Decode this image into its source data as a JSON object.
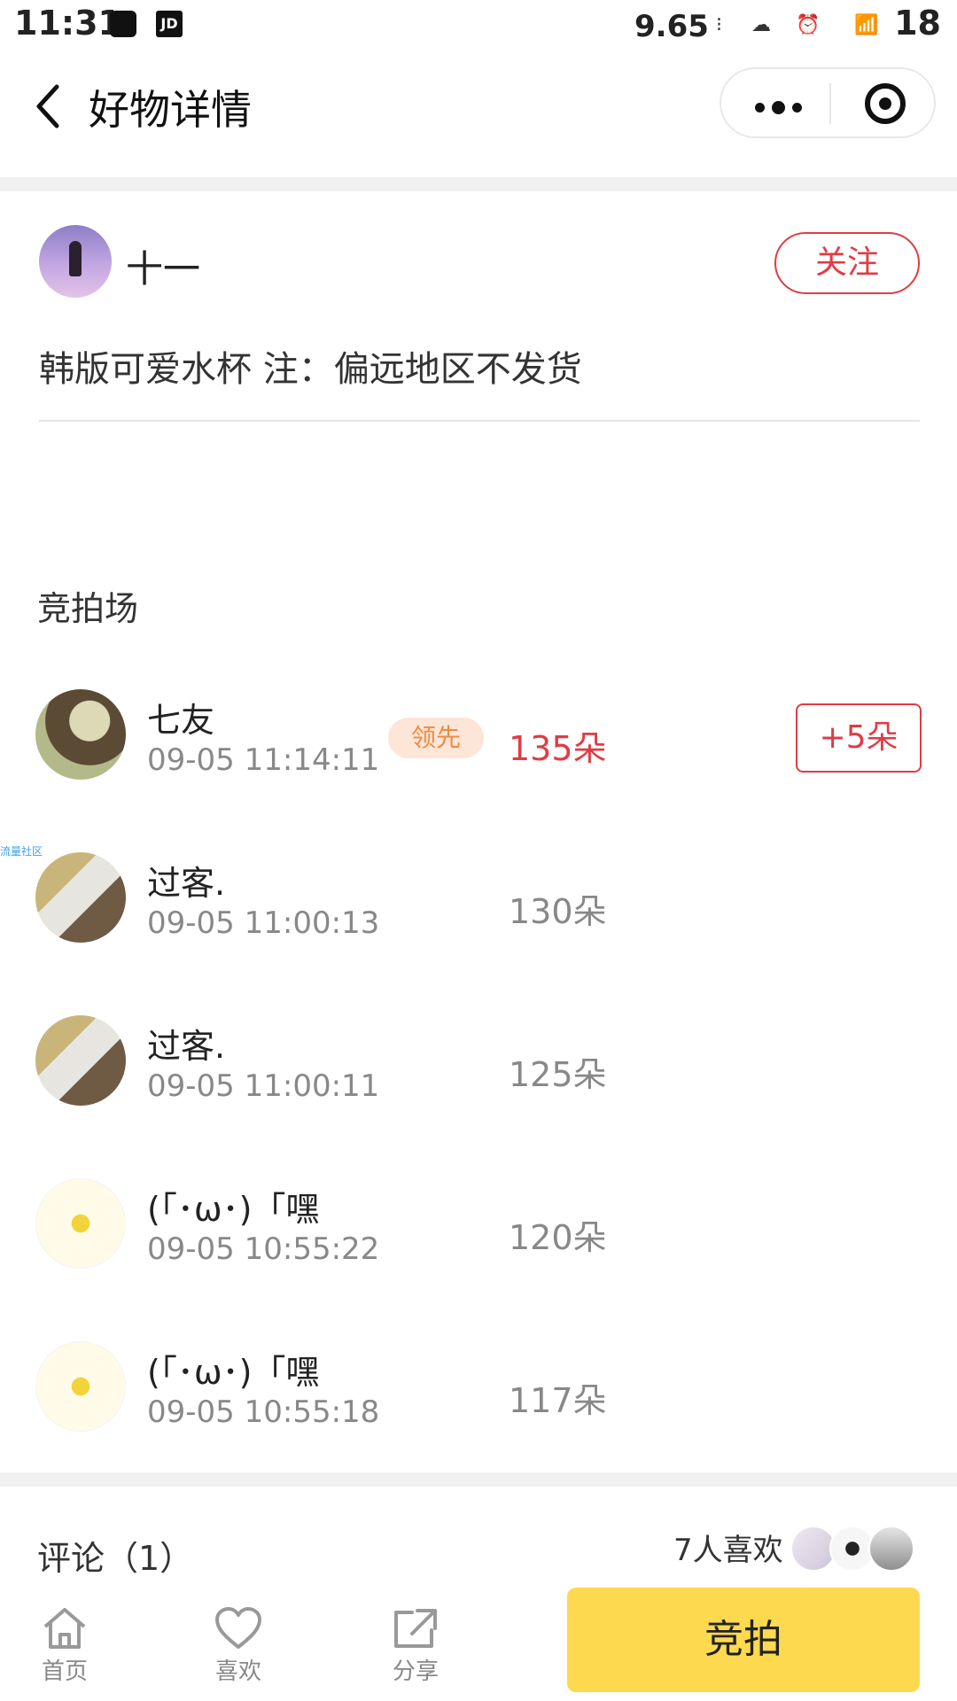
{
  "status_bar": {
    "time": "11:31",
    "speed": "9.65",
    "battery": "18",
    "icons": [
      "qq-icon",
      "jd-icon",
      "speed-unit-icon",
      "cloud-icon",
      "alarm-icon",
      "signal-icon"
    ]
  },
  "header": {
    "title": "好物详情"
  },
  "post": {
    "author": "十一",
    "follow_label": "关注",
    "description": "韩版可爱水杯 注：偏远地区不发货"
  },
  "auction": {
    "section_title": "竞拍场",
    "lead_label": "领先",
    "raise_label": "+5朵",
    "watermark": "流量社区",
    "bids": [
      {
        "name": "七友",
        "time": "09-05 11:14:11",
        "amount": "135朵"
      },
      {
        "name": "过客.",
        "time": "09-05 11:00:13",
        "amount": "130朵"
      },
      {
        "name": "过客.",
        "time": "09-05 11:00:11",
        "amount": "125朵"
      },
      {
        "name": "(「･ω･)「嘿",
        "time": "09-05 10:55:22",
        "amount": "120朵"
      },
      {
        "name": "(「･ω･)「嘿",
        "time": "09-05 10:55:18",
        "amount": "117朵"
      }
    ]
  },
  "comments": {
    "label": "评论（1）"
  },
  "likes": {
    "label": "7人喜欢"
  },
  "tabbar": {
    "home": "首页",
    "like": "喜欢",
    "share": "分享",
    "bid_button": "竞拍"
  },
  "colors": {
    "accent_red": "#e03c45",
    "bid_yellow": "#fcd94f",
    "lead_badge_bg": "#fde6d7",
    "lead_badge_text": "#ef8a43"
  }
}
